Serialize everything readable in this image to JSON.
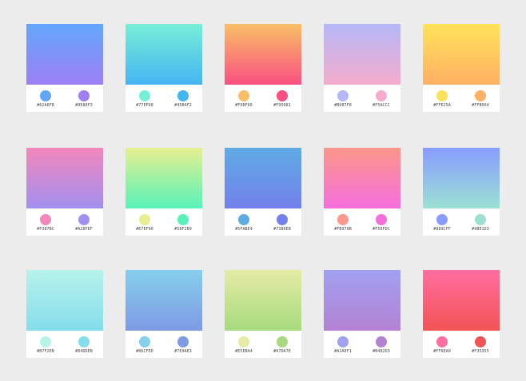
{
  "palettes": [
    {
      "top": "#62A6FB",
      "bottom": "#9E80F3"
    },
    {
      "top": "#77EFD8",
      "bottom": "#45B4F2"
    },
    {
      "top": "#F9BF66",
      "bottom": "#F95081"
    },
    {
      "top": "#B6B7F8",
      "bottom": "#F5ACCC"
    },
    {
      "top": "#FFE25A",
      "bottom": "#FFB064"
    },
    {
      "top": "#F387BC",
      "bottom": "#A28FEF"
    },
    {
      "top": "#E7EF90",
      "bottom": "#58F2B9"
    },
    {
      "top": "#5FABE4",
      "bottom": "#7380EB"
    },
    {
      "top": "#FB978B",
      "bottom": "#F56FDC"
    },
    {
      "top": "#889CFF",
      "bottom": "#9BE1D3"
    },
    {
      "top": "#B7F2EB",
      "bottom": "#84DDEB"
    },
    {
      "top": "#86CFED",
      "bottom": "#7E9AE3"
    },
    {
      "top": "#E5EBA4",
      "bottom": "#A7DA7E"
    },
    {
      "top": "#A1A0F1",
      "bottom": "#B482D3"
    },
    {
      "top": "#FF6EA0",
      "bottom": "#F35355"
    }
  ]
}
